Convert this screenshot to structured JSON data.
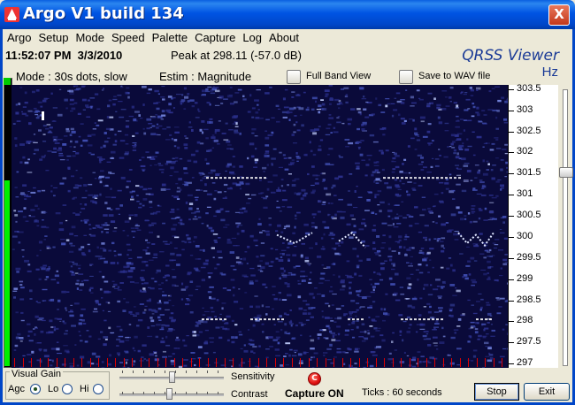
{
  "window": {
    "title": "Argo V1 build 134",
    "close_glyph": "X"
  },
  "menu": [
    "Argo",
    "Setup",
    "Mode",
    "Speed",
    "Palette",
    "Capture",
    "Log",
    "About"
  ],
  "status": {
    "time": "11:52:07 PM",
    "date": "3/3/2010",
    "peak": "Peak at 298.11 (-57.0 dB)",
    "mode": "Mode : 30s dots, slow",
    "estim": "Estim : Magnitude"
  },
  "logo": "QRSS Viewer",
  "toggles": {
    "full_band": "Full Band View",
    "save_wav": "Save to WAV file"
  },
  "scale": {
    "unit": "Hz",
    "labels": [
      "303.5",
      "303",
      "302.5",
      "302",
      "301.5",
      "301",
      "300.5",
      "300",
      "299.5",
      "299",
      "298.5",
      "298",
      "297.5",
      "297"
    ],
    "range_hz": [
      296.9,
      303.6
    ]
  },
  "waterfall": {
    "background_color": "#0a0a3a",
    "signal_color": "#ffffff"
  },
  "controls": {
    "visual_gain_label": "Visual Gain",
    "agc_label": "Agc",
    "lo_label": "Lo",
    "hi_label": "Hi",
    "selected_gain": "Agc",
    "sensitivity_label": "Sensitivity",
    "contrast_label": "Contrast",
    "capture_led_glyph": "C",
    "capture_status": "Capture ON",
    "ticks": "Ticks   : 60 seconds",
    "stop_label": "Stop",
    "exit_label": "Exit"
  },
  "meter_level": 0.66,
  "right_slider_level": 0.3
}
